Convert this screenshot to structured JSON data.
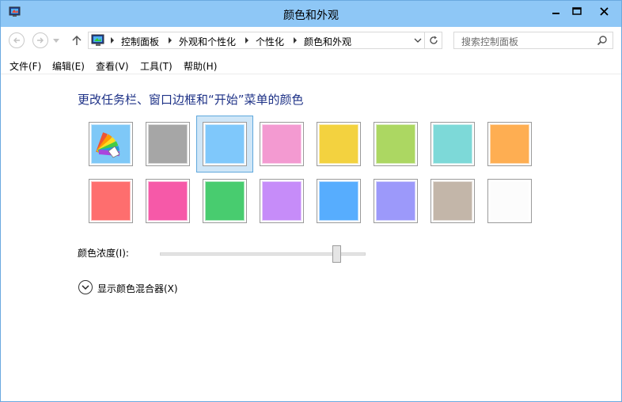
{
  "window": {
    "title": "颜色和外观"
  },
  "nav": {
    "breadcrumbs": [
      "控制面板",
      "外观和个性化",
      "个性化",
      "颜色和外观"
    ],
    "search_placeholder": "搜索控制面板"
  },
  "menu": [
    "文件(F)",
    "编辑(E)",
    "查看(V)",
    "工具(T)",
    "帮助(H)"
  ],
  "content": {
    "heading": "更改任务栏、窗口边框和“开始”菜单的颜色",
    "swatches_row1": [
      {
        "name": "custom-color",
        "color": "#7ec8f7",
        "icon": "palette-icon"
      },
      {
        "name": "gray",
        "color": "#a6a6a6"
      },
      {
        "name": "sky-blue",
        "color": "#7fc8fb",
        "selected": true
      },
      {
        "name": "pink",
        "color": "#f39ad1"
      },
      {
        "name": "yellow",
        "color": "#f3d23f"
      },
      {
        "name": "lime",
        "color": "#acd762"
      },
      {
        "name": "teal",
        "color": "#7dd9d8"
      },
      {
        "name": "orange",
        "color": "#feae52"
      }
    ],
    "swatches_row2": [
      {
        "name": "red",
        "color": "#fe6e6e"
      },
      {
        "name": "magenta",
        "color": "#f659a8"
      },
      {
        "name": "green",
        "color": "#48cc6f"
      },
      {
        "name": "violet",
        "color": "#c68cf9"
      },
      {
        "name": "blue",
        "color": "#57adfe"
      },
      {
        "name": "periwinkle",
        "color": "#9c99fa"
      },
      {
        "name": "taupe",
        "color": "#c3b6a9"
      },
      {
        "name": "white",
        "color": "#fcfcfc"
      }
    ],
    "intensity_label": "颜色浓度(I):",
    "intensity_value": 0.86,
    "mixer_label": "显示颜色混合器(X)"
  }
}
